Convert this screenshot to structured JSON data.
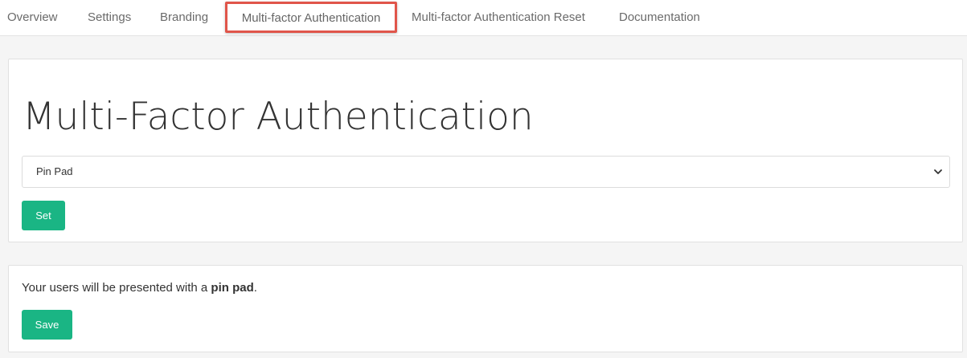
{
  "tabs": {
    "overview": "Overview",
    "settings": "Settings",
    "branding": "Branding",
    "mfa": "Multi-factor Authentication",
    "mfa_reset": "Multi-factor Authentication Reset",
    "documentation": "Documentation",
    "active": "mfa",
    "highlight_color": "#e0554a"
  },
  "mfa_card": {
    "title": "Multi-Factor Authentication",
    "select": {
      "selected": "Pin Pad",
      "icon": "chevron-down-icon"
    },
    "set_label": "Set"
  },
  "info_card": {
    "text_prefix": "Your users will be presented with a ",
    "text_bold": "pin pad",
    "text_suffix": ".",
    "save_label": "Save"
  },
  "colors": {
    "accent": "#1ab584",
    "background": "#f5f5f5"
  }
}
